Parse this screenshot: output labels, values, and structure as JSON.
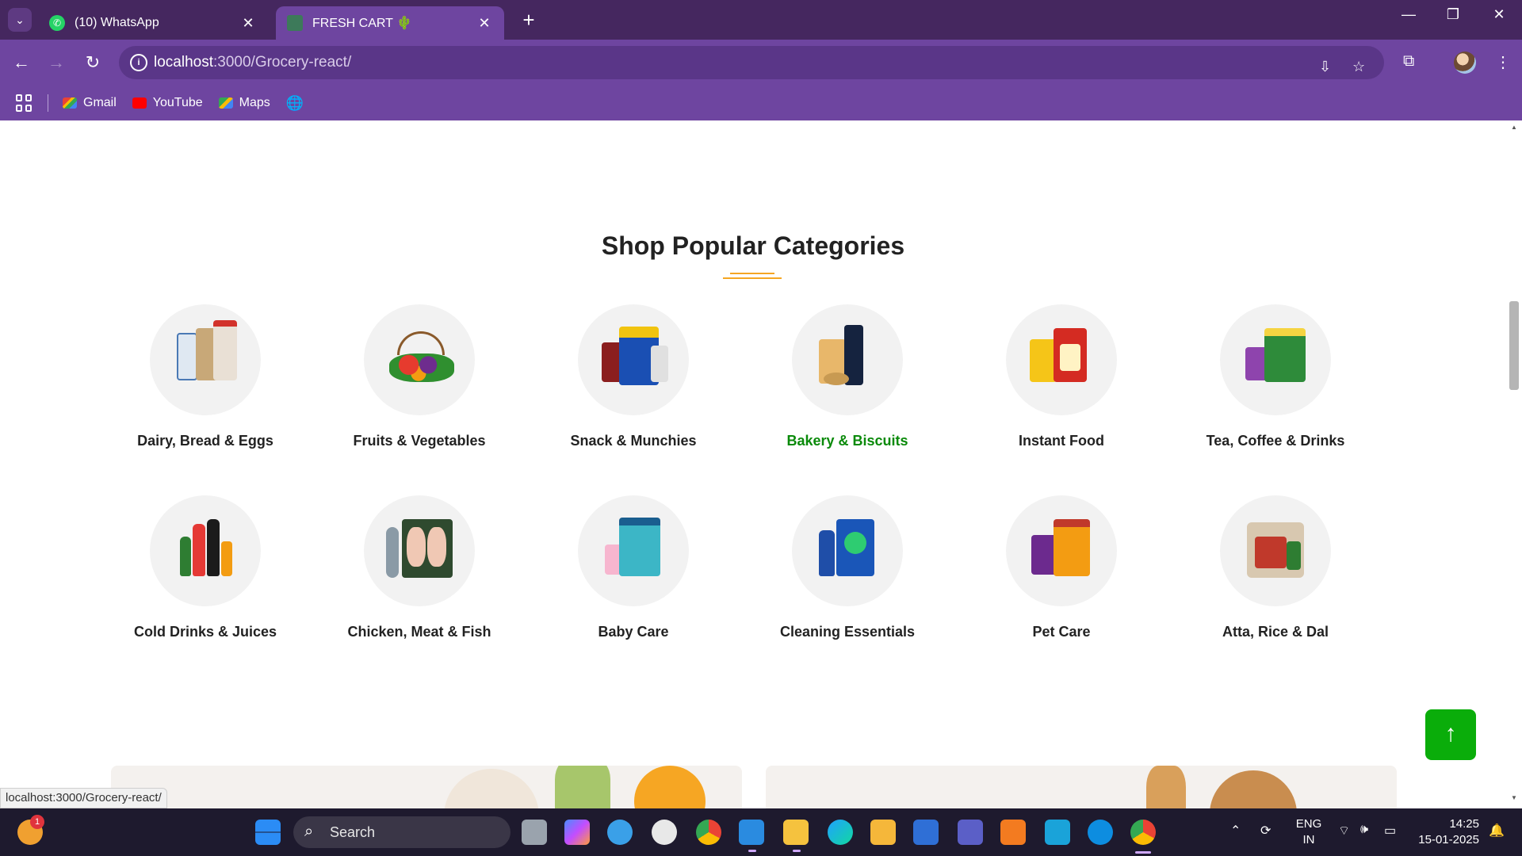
{
  "browser": {
    "tabs": [
      {
        "title": "(10) WhatsApp",
        "active": false,
        "icon": "whatsapp-icon"
      },
      {
        "title": "FRESH CART 🌵",
        "active": true,
        "icon": "fresh-cart-favicon"
      }
    ],
    "url_host": "localhost",
    "url_path": ":3000/Grocery-react/",
    "bookmarks": [
      {
        "label": "Gmail",
        "icon": "gmail-icon"
      },
      {
        "label": "YouTube",
        "icon": "youtube-icon"
      },
      {
        "label": "Maps",
        "icon": "maps-icon"
      }
    ],
    "status_tooltip": "localhost:3000/Grocery-react/"
  },
  "page": {
    "section_title": "Shop Popular Categories",
    "accent_color": "#0aad0a",
    "categories": [
      {
        "label": "Dairy, Bread & Eggs",
        "active": false
      },
      {
        "label": "Fruits & Vegetables",
        "active": false
      },
      {
        "label": "Snack & Munchies",
        "active": false
      },
      {
        "label": "Bakery & Biscuits",
        "active": true
      },
      {
        "label": "Instant Food",
        "active": false
      },
      {
        "label": "Tea, Coffee & Drinks",
        "active": false
      },
      {
        "label": "Cold Drinks & Juices",
        "active": false
      },
      {
        "label": "Chicken, Meat & Fish",
        "active": false
      },
      {
        "label": "Baby Care",
        "active": false
      },
      {
        "label": "Cleaning Essentials",
        "active": false
      },
      {
        "label": "Pet Care",
        "active": false
      },
      {
        "label": "Atta, Rice & Dal",
        "active": false
      }
    ],
    "scroll_top_label": "↑"
  },
  "taskbar": {
    "search_placeholder": "Search",
    "notification_count": "1",
    "language": "ENG",
    "region": "IN",
    "time": "14:25",
    "date": "15-01-2025"
  }
}
